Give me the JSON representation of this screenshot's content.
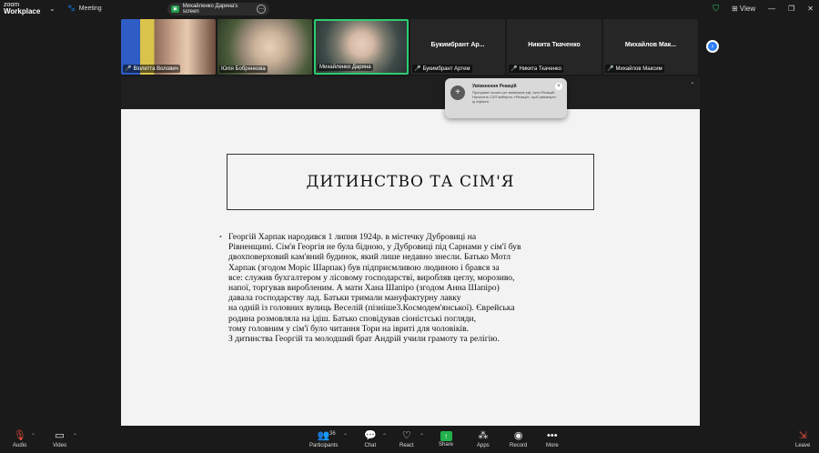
{
  "app": {
    "logo_line1": "zoom",
    "logo_line2": "Workplace",
    "meeting_label": "Meeting",
    "screen_share_label": "Михайленко Дарина's screen",
    "view_label": "View"
  },
  "participants": [
    {
      "name": "Віолетта Волович",
      "muted": true,
      "video": true
    },
    {
      "name": "Юлія Бобренкова",
      "muted": false,
      "video": true
    },
    {
      "name": "Михайленко Дарина",
      "muted": false,
      "video": true,
      "active": true
    },
    {
      "name": "Букимбрант Артем",
      "display": "Букимбрант Ар...",
      "muted": true,
      "video": false
    },
    {
      "name": "Никита Ткаченко",
      "display": "Никита Ткаченко",
      "muted": true,
      "video": false
    },
    {
      "name": "Михайлов Максим",
      "display": "Михайлов Мак...",
      "muted": true,
      "video": false
    }
  ],
  "toast": {
    "title": "Увімкнення Реакцій",
    "body": "Програма «zoom.us» вимкнула еф- екти Реакцій. Натисніть СЗП виберіть «Реакції», щоб увімкнути ці ефекти."
  },
  "slide": {
    "title": "ДИТИНСТВО ТА СІМ'Я",
    "bullet": "•",
    "lines": [
      "Георгій Харпак народився 1 липня 1924р. в містечку Дубровиці на",
      "Рівненщині. Сім'я Георгія не була бідною, у Дубровиці під Сарнами у сім'ї був",
      "двохповерховий кам'яний будинок, який лише недавно знесли. Батько Мотл",
      "Харпак (згодом Моріс Шарпак) був підприємливою людиною і брався за",
      "все: служив бухгалтером у лісовому господарстві, виробляв цеглу, морозиво,",
      "напої, торгував виробленим. А мати Хана Шапіро (згодом Анна Шапіро)",
      "давала господарству лад. Батьки тримали мануфактурну лавку",
      "на одній із головних вулиць Веселій (пізніше3.Космодем'янської). Єврейська",
      "родина розмовляла на ідіш. Батько сповідував сіоністські погляди,",
      "тому головним у сім'ї було читання Тори на івриті для чоловіків.",
      "З дитинства Георгій та молодший брат Андрій учили грамоту та релігію."
    ]
  },
  "toolbar": {
    "audio": "Audio",
    "video": "Video",
    "participants": "Participants",
    "participants_count": "36",
    "chat": "Chat",
    "react": "React",
    "share": "Share",
    "apps": "Apps",
    "record": "Record",
    "more": "More",
    "leave": "Leave"
  },
  "colors": {
    "accent_green": "#2ecc71",
    "share_green": "#22b14c",
    "leave_red": "#e74c3c",
    "next_blue": "#2d7df6"
  }
}
